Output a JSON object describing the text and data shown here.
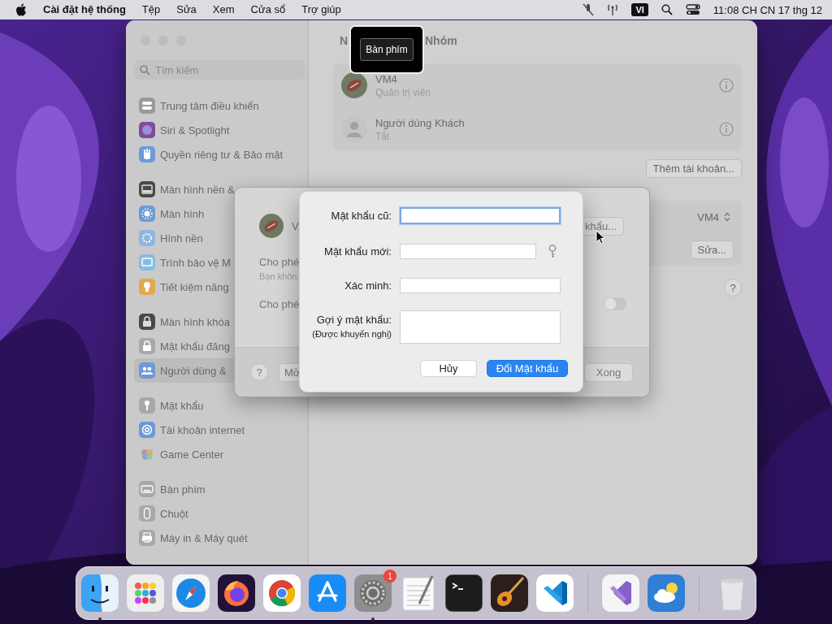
{
  "menu_bar": {
    "app_name": "Cài đặt hệ thống",
    "menus": [
      "Tệp",
      "Sửa",
      "Xem",
      "Cửa sổ",
      "Trợ giúp"
    ],
    "input_source": "VI",
    "clock": "11:08 CH CN 17 thg 12"
  },
  "settings_window": {
    "search": {
      "placeholder": "Tìm kiếm"
    },
    "sidebar": {
      "groups": [
        {
          "items": [
            {
              "label": "Trung tâm điều khiển",
              "selected": false
            },
            {
              "label": "Siri & Spotlight",
              "selected": false
            },
            {
              "label": "Quyền riêng tư & Bảo mật",
              "selected": false
            }
          ]
        },
        {
          "items": [
            {
              "label": "Màn hình nền &",
              "selected": false
            },
            {
              "label": "Màn hình",
              "selected": false
            },
            {
              "label": "Hình nền",
              "selected": false
            },
            {
              "label": "Trình bảo vệ M",
              "selected": false
            },
            {
              "label": "Tiết kiệm năng",
              "selected": false
            }
          ]
        },
        {
          "items": [
            {
              "label": "Màn hình khóa",
              "selected": false
            },
            {
              "label": "Mật khẩu đăng",
              "selected": false
            },
            {
              "label": "Người dùng &",
              "selected": true
            }
          ]
        },
        {
          "items": [
            {
              "label": "Mật khẩu",
              "selected": false
            },
            {
              "label": "Tài khoản internet",
              "selected": false
            },
            {
              "label": "Game Center",
              "selected": false
            }
          ]
        },
        {
          "items": [
            {
              "label": "Bàn phím",
              "selected": false
            },
            {
              "label": "Chuột",
              "selected": false
            },
            {
              "label": "Máy in & Máy quét",
              "selected": false
            }
          ]
        }
      ]
    },
    "title_start": "N",
    "title_end": "Nhóm",
    "users": [
      {
        "name": "VM4",
        "role": "Quản trị viên"
      },
      {
        "kind": "guest",
        "name": "Người dùng Khách",
        "role": "Tắt"
      }
    ],
    "add_account_button": "Thêm tài khoản...",
    "login_account_popup": "VM4",
    "edit_button": "Sửa...",
    "help_button": "?"
  },
  "user_sheet": {
    "name": "V",
    "change_password_button": "khẩu...",
    "options": [
      {
        "label": "Cho phé",
        "note": "Bạn khôn"
      },
      {
        "label": "Cho phé",
        "toggle_on": false
      }
    ],
    "help_button": "?",
    "open_button": "Mở",
    "done_button": "Xong"
  },
  "password_dialog": {
    "fields": [
      {
        "kind": "single",
        "label": "Mật khẩu cũ:",
        "focused": true
      },
      {
        "kind": "with_key",
        "label": "Mật khẩu mới:",
        "focused": false
      },
      {
        "kind": "single",
        "label": "Xác minh:",
        "focused": false
      },
      {
        "kind": "multiline",
        "label": "Gợi ý mật khẩu:",
        "note": "(Được khuyến nghị)",
        "focused": false
      }
    ],
    "cancel_button": "Hủy",
    "confirm_button": "Đổi Mật khẩu"
  },
  "tooltip": {
    "label": "Bàn phím"
  },
  "dock": {
    "items": [
      {
        "kind": "app",
        "running": true
      },
      {
        "kind": "app",
        "running": false
      },
      {
        "kind": "app",
        "running": false
      },
      {
        "kind": "app",
        "running": false
      },
      {
        "kind": "app",
        "running": false
      },
      {
        "kind": "app",
        "running": false
      },
      {
        "kind": "app",
        "running": true,
        "badge": "1"
      },
      {
        "kind": "app",
        "running": false
      },
      {
        "kind": "app",
        "running": false
      },
      {
        "kind": "app",
        "running": false
      },
      {
        "kind": "app",
        "running": false
      },
      {
        "kind": "separator"
      },
      {
        "kind": "app",
        "running": false
      },
      {
        "kind": "app",
        "running": false
      },
      {
        "kind": "separator"
      },
      {
        "kind": "app",
        "running": false
      }
    ]
  }
}
